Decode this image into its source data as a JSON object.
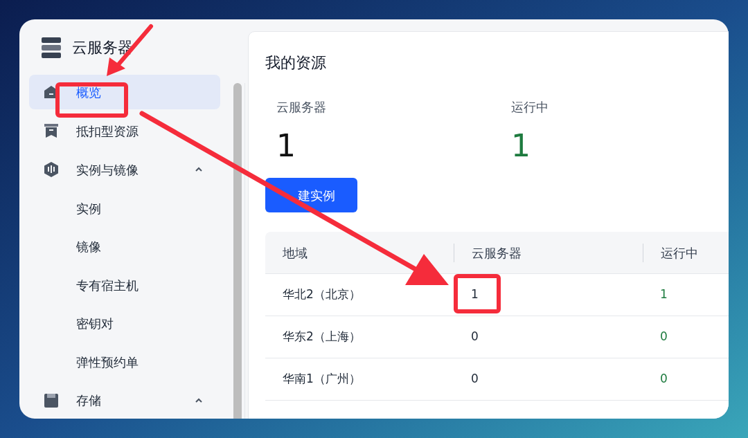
{
  "sidebar": {
    "title": "云服务器",
    "items": [
      {
        "label": "概览",
        "selected": true
      },
      {
        "label": "抵扣型资源",
        "selected": false
      },
      {
        "label": "实例与镜像",
        "selected": false,
        "expanded": true,
        "children": [
          {
            "label": "实例",
            "selected": false
          },
          {
            "label": "镜像",
            "selected": false
          },
          {
            "label": "专有宿主机",
            "selected": false
          },
          {
            "label": "密钥对",
            "selected": false
          },
          {
            "label": "弹性预约单",
            "selected": false
          }
        ]
      },
      {
        "label": "存储",
        "selected": false,
        "expanded": true
      }
    ]
  },
  "main": {
    "title": "我的资源",
    "stats": [
      {
        "label": "云服务器",
        "value": "1",
        "kind": "total"
      },
      {
        "label": "运行中",
        "value": "1",
        "kind": "running"
      }
    ],
    "create_button": "建实例",
    "table": {
      "columns": [
        "地域",
        "云服务器",
        "运行中"
      ],
      "rows": [
        [
          "华北2（北京）",
          "1",
          "1"
        ],
        [
          "华东2（上海）",
          "0",
          "0"
        ],
        [
          "华南1（广州）",
          "0",
          "0"
        ]
      ]
    }
  }
}
